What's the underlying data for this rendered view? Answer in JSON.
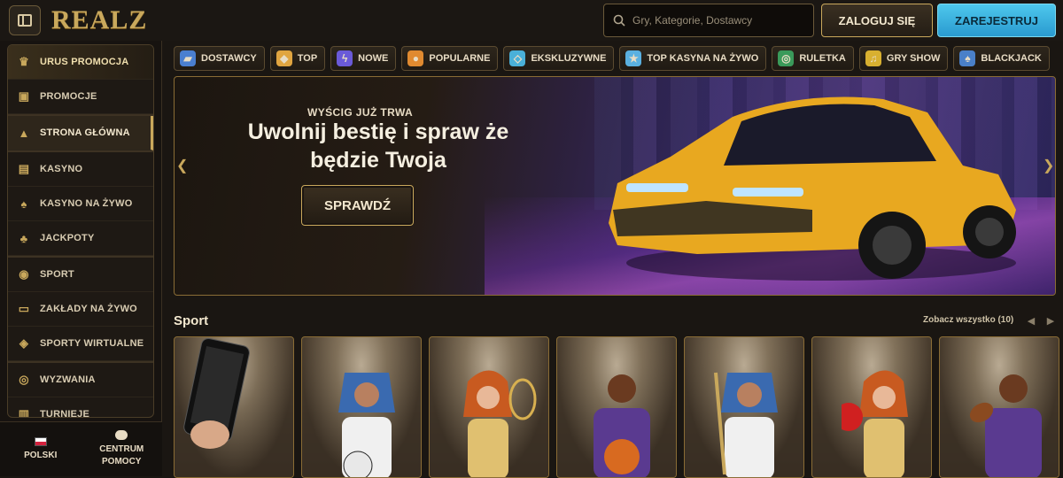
{
  "header": {
    "logo": "REALZ",
    "search_placeholder": "Gry, Kategorie, Dostawcy",
    "login_label": "ZALOGUJ SIĘ",
    "register_label": "ZAREJESTRUJ"
  },
  "sidebar": {
    "items": [
      {
        "label": "URUS PROMOCJA",
        "icon": "trophy-icon"
      },
      {
        "label": "PROMOCJE",
        "icon": "gift-icon"
      },
      {
        "label": "STRONA GŁÓWNA",
        "icon": "home-icon"
      },
      {
        "label": "KASYNO",
        "icon": "slot-icon"
      },
      {
        "label": "KASYNO NA ŻYWO",
        "icon": "cards-icon"
      },
      {
        "label": "JACKPOTY",
        "icon": "clover-icon"
      },
      {
        "label": "SPORT",
        "icon": "ball-icon"
      },
      {
        "label": "ZAKŁADY NA ŻYWO",
        "icon": "live-icon"
      },
      {
        "label": "SPORTY WIRTUALNE",
        "icon": "virtual-icon"
      },
      {
        "label": "WYZWANIA",
        "icon": "target-icon"
      },
      {
        "label": "TURNIEJE",
        "icon": "podium-icon"
      }
    ],
    "language": "POLSKI",
    "help_line1": "CENTRUM",
    "help_line2": "POMOCY"
  },
  "categories": [
    {
      "label": "DOSTAWCY",
      "color": "#4a7fd0"
    },
    {
      "label": "TOP",
      "color": "#e0a540"
    },
    {
      "label": "NOWE",
      "color": "#6a5ad8"
    },
    {
      "label": "POPULARNE",
      "color": "#e08a30"
    },
    {
      "label": "EKSKLUZYWNE",
      "color": "#4ab0d8"
    },
    {
      "label": "TOP KASYNA NA ŻYWO",
      "color": "#5ab0e0"
    },
    {
      "label": "RULETKA",
      "color": "#3a9a5a"
    },
    {
      "label": "GRY SHOW",
      "color": "#d8b030"
    },
    {
      "label": "BLACKJACK",
      "color": "#4a80c8"
    }
  ],
  "hero": {
    "subtitle": "WYŚCIG JUŻ TRWA",
    "title_line1": "Uwolnij bestię i spraw że",
    "title_line2": "będzie Twoja",
    "cta": "SPRAWDŹ"
  },
  "sport_section": {
    "title": "Sport",
    "see_all": "Zobacz wszystko (10)"
  },
  "cards": [
    {
      "theme": "phone-betting"
    },
    {
      "theme": "pharaoh-soccer"
    },
    {
      "theme": "cleopatra-tennis"
    },
    {
      "theme": "basketball-player"
    },
    {
      "theme": "pharaoh-hockey"
    },
    {
      "theme": "cleopatra-pingpong"
    },
    {
      "theme": "football-player"
    }
  ],
  "colors": {
    "gold": "#c9a85c",
    "register_blue": "#3ab0e0",
    "bg": "#1a1612"
  }
}
